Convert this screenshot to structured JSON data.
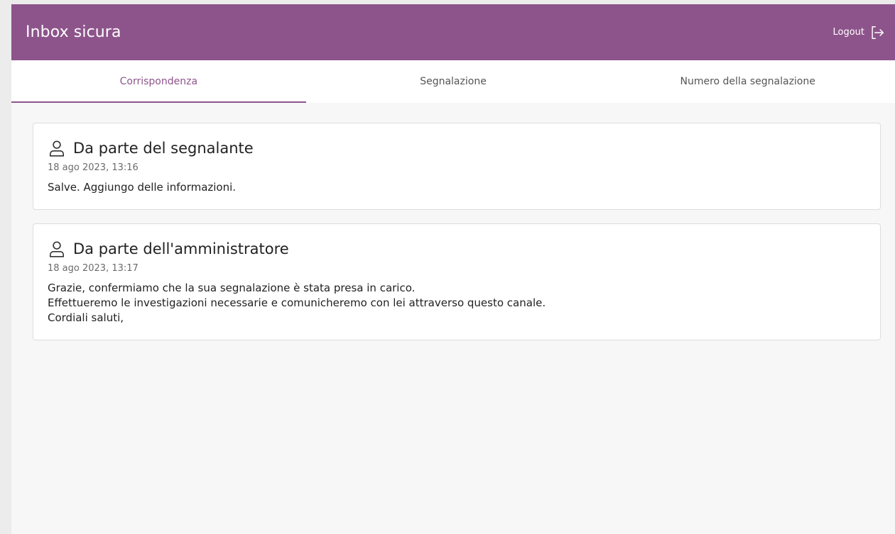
{
  "header": {
    "title": "Inbox sicura",
    "logout_label": "Logout",
    "logout_icon": "logout-icon",
    "background": "#8d548b"
  },
  "tabs": [
    {
      "label": "Corrispondenza",
      "active": true
    },
    {
      "label": "Segnalazione",
      "active": false
    },
    {
      "label": "Numero della segnalazione",
      "active": false
    }
  ],
  "messages": [
    {
      "icon": "user-icon",
      "title": "Da parte del segnalante",
      "date": "18 ago 2023, 13:16",
      "lines": [
        "Salve. Aggiungo delle informazioni."
      ]
    },
    {
      "icon": "user-icon",
      "title": "Da parte dell'amministratore",
      "date": "18 ago 2023, 13:17",
      "lines": [
        "Grazie, confermiamo che la sua segnalazione è stata presa in carico.",
        "Effettueremo le investigazioni necessarie e comunicheremo con lei attraverso questo canale.",
        "Cordiali saluti,"
      ]
    }
  ]
}
